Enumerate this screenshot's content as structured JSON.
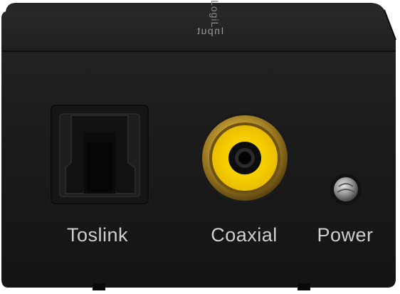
{
  "device": {
    "top_label": "Input",
    "logo_text": "LogiL",
    "ports": [
      {
        "id": "toslink",
        "label": "Toslink"
      },
      {
        "id": "coaxial",
        "label": "Coaxial"
      },
      {
        "id": "power",
        "label": "Power"
      }
    ]
  },
  "colors": {
    "housing": "#1c1c1c",
    "coax_ring": "#f4d000",
    "gold": "#c9a235",
    "label_text": "#cfcfcf"
  },
  "icons": [
    "toslink-port-icon",
    "rca-jack-icon",
    "power-led-icon"
  ]
}
